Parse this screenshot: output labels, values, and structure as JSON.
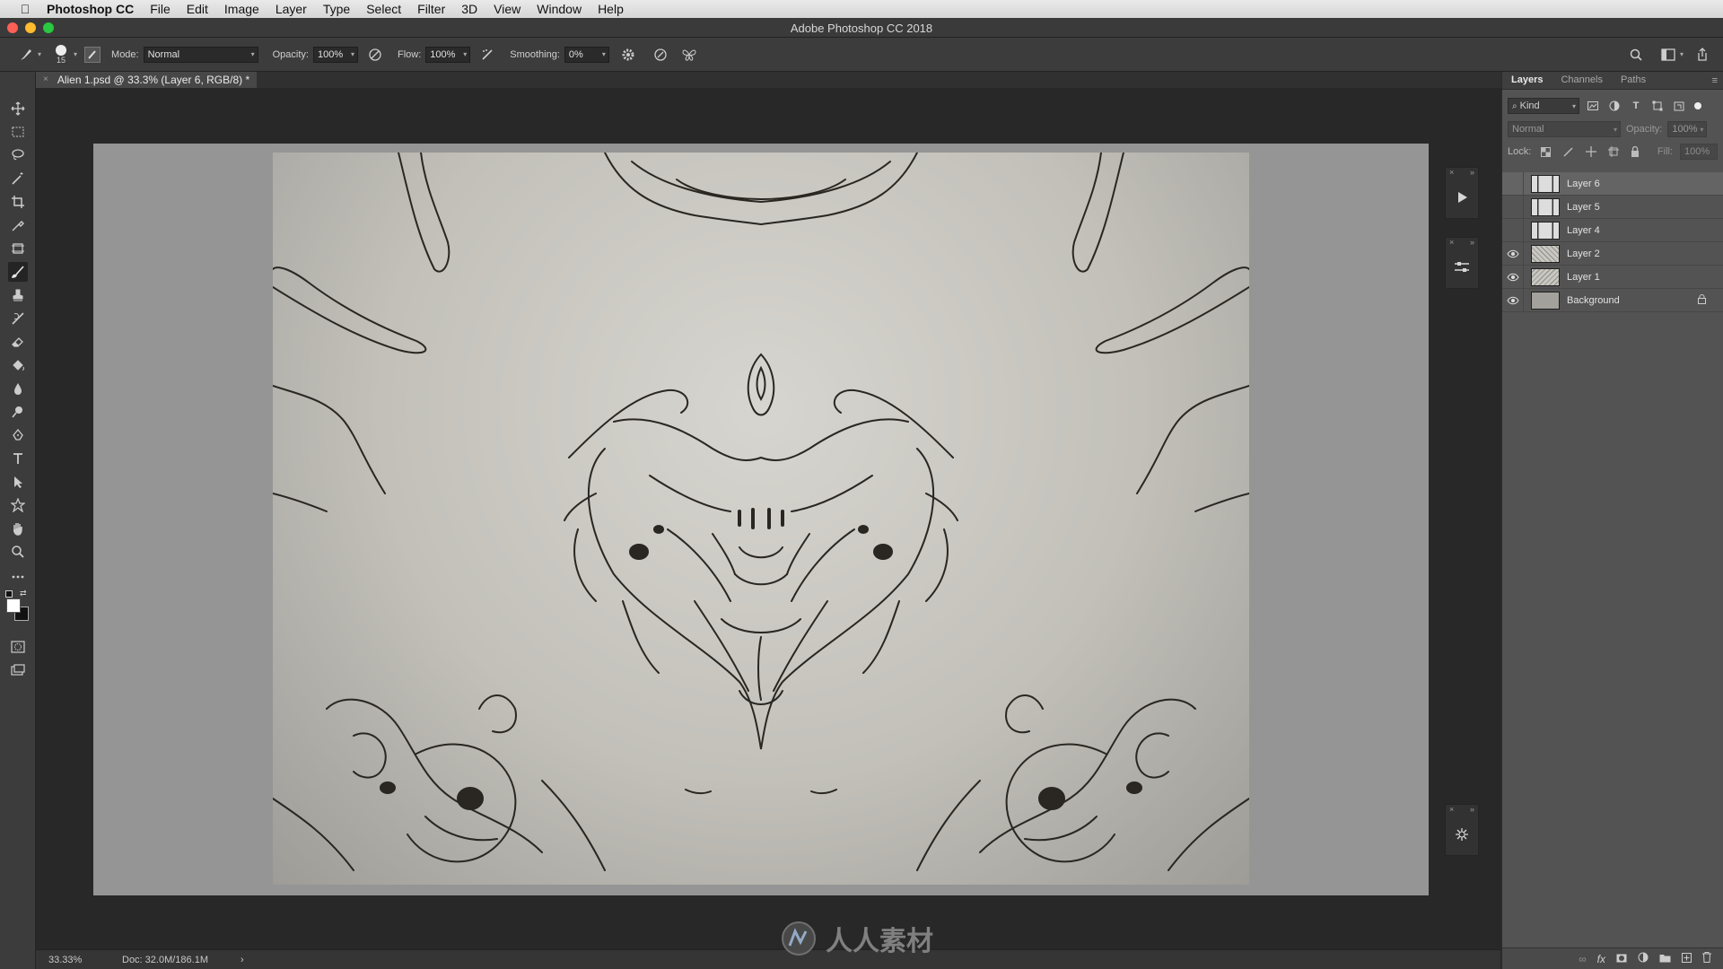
{
  "menubar": {
    "apple_icon": "apple-icon",
    "app_name": "Photoshop CC",
    "items": [
      "File",
      "Edit",
      "Image",
      "Layer",
      "Type",
      "Select",
      "Filter",
      "3D",
      "View",
      "Window",
      "Help"
    ]
  },
  "window": {
    "title": "Adobe Photoshop CC 2018",
    "close_color": "#ff5f57",
    "minimize_color": "#febc2e",
    "zoom_color": "#28c840"
  },
  "options": {
    "brush_size": "15",
    "mode_label": "Mode:",
    "mode_value": "Normal",
    "opacity_label": "Opacity:",
    "opacity_value": "100%",
    "flow_label": "Flow:",
    "flow_value": "100%",
    "smoothing_label": "Smoothing:",
    "smoothing_value": "0%"
  },
  "document": {
    "tab_title": "Alien 1.psd @ 33.3% (Layer 6, RGB/8) *",
    "close_glyph": "×"
  },
  "status": {
    "zoom": "33.33%",
    "doc_size": "Doc: 32.0M/186.1M",
    "arrow": "›"
  },
  "panel": {
    "tabs": [
      "Layers",
      "Channels",
      "Paths"
    ],
    "kind_filter": "Kind",
    "blend_mode": "Normal",
    "opacity_label": "Opacity:",
    "opacity_value": "100%",
    "lock_label": "Lock:",
    "fill_label": "Fill:",
    "fill_value": "100%",
    "layers": [
      {
        "name": "Layer 6",
        "visible": false,
        "selected": true
      },
      {
        "name": "Layer 5",
        "visible": false,
        "selected": false
      },
      {
        "name": "Layer 4",
        "visible": false,
        "selected": false
      },
      {
        "name": "Layer 2",
        "visible": true,
        "selected": false
      },
      {
        "name": "Layer 1",
        "visible": true,
        "selected": false
      },
      {
        "name": "Background",
        "visible": true,
        "selected": false,
        "locked": true
      }
    ]
  },
  "watermark": {
    "text": "人人素材"
  },
  "colors": {
    "menubar": "#dcdcdc",
    "chrome": "#3c3c3c",
    "workspace": "#282828",
    "canvas_surround": "#959595",
    "panel": "#535353"
  }
}
